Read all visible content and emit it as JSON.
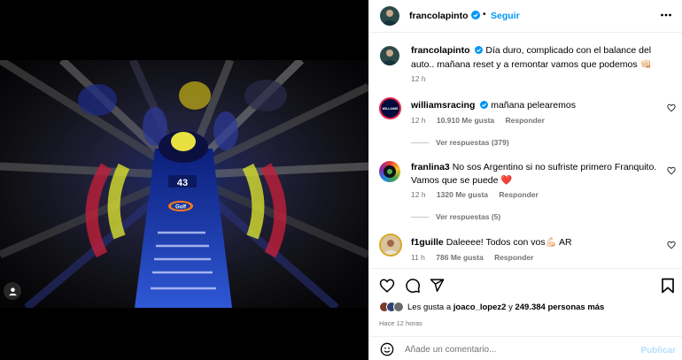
{
  "post": {
    "author": "francolapinto",
    "follow_label": "Seguir",
    "caption": "Día duro, complicado con el balance del auto.. mañana reset y a remontar vamos que podemos 👊🏻",
    "caption_time": "12 h",
    "car_number": "43",
    "sponsor": "Gulf"
  },
  "comments": [
    {
      "username": "williamsracing",
      "verified": true,
      "text": "mañana pelearemos",
      "time": "12 h",
      "likes": "10.910 Me gusta",
      "reply_label": "Responder",
      "view_replies": "Ver respuestas (379)"
    },
    {
      "username": "franlina3",
      "verified": false,
      "text": "No sos Argentino si no sufriste primero Franquito. Vamos que se puede ❤️",
      "time": "12 h",
      "likes": "1320 Me gusta",
      "reply_label": "Responder",
      "view_replies": "Ver respuestas (5)"
    },
    {
      "username": "f1guille",
      "verified": false,
      "text": "Daleeee! Todos con vos💪🏻 AR",
      "time": "11 h",
      "likes": "786 Me gusta",
      "reply_label": "Responder"
    }
  ],
  "likes_summary": {
    "prefix": "Les gusta a",
    "user": "joaco_lopez2",
    "connector": "y",
    "others": "249.384 personas más"
  },
  "posted_time": "Hace 12 horas",
  "add_comment": {
    "placeholder": "Añade un comentario...",
    "publish_label": "Publicar"
  },
  "colors": {
    "accent": "#0095f6",
    "publish_disabled": "#b2dffc",
    "muted": "#737373",
    "heart_red": "#ed1c3a"
  }
}
